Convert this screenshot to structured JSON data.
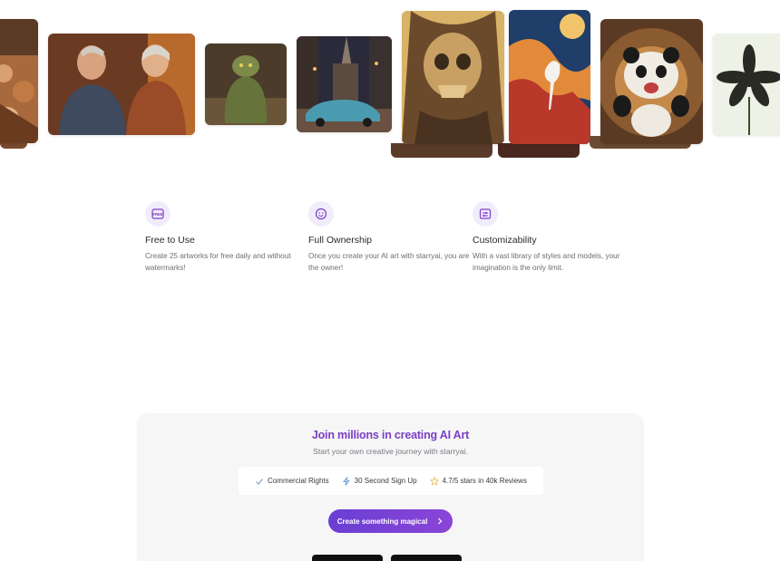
{
  "gallery": {
    "images": [
      {
        "subject": "crowd-painting"
      },
      {
        "subject": "elderly-couple-painting"
      },
      {
        "subject": "green-troll-figure"
      },
      {
        "subject": "vintage-car-city-night"
      },
      {
        "subject": "skull-sculpture"
      },
      {
        "subject": "heron-with-swirls"
      },
      {
        "subject": "panda-in-lights"
      },
      {
        "subject": "dark-flower"
      }
    ]
  },
  "features": [
    {
      "icon": "free-tag-icon",
      "title": "Free to Use",
      "description": "Create 25 artworks for free daily and without watermarks!"
    },
    {
      "icon": "smiley-badge-icon",
      "title": "Full Ownership",
      "description": "Once you create your AI art with starryai, you are the owner!"
    },
    {
      "icon": "sliders-image-icon",
      "title": "Customizability",
      "description": "With a vast library of styles and models, your imagination is the only limit."
    }
  ],
  "join": {
    "title": "Join millions in creating AI Art",
    "subtitle": "Start your own creative journey with starryai.",
    "perks": [
      {
        "icon": "check-icon",
        "label": "Commercial Rights"
      },
      {
        "icon": "lightning-icon",
        "label": "30 Second Sign Up"
      },
      {
        "icon": "star-icon",
        "label": "4.7/5 stars in 40k Reviews"
      }
    ],
    "cta_label": "Create something magical",
    "cta_icon": "chevron-right-icon"
  },
  "colors": {
    "accent": "#7b3fc4",
    "button_start": "#6a3ed4",
    "button_end": "#8a45d6",
    "card_bg": "#f6f6f7",
    "icon_bg": "#f1ecfb"
  }
}
